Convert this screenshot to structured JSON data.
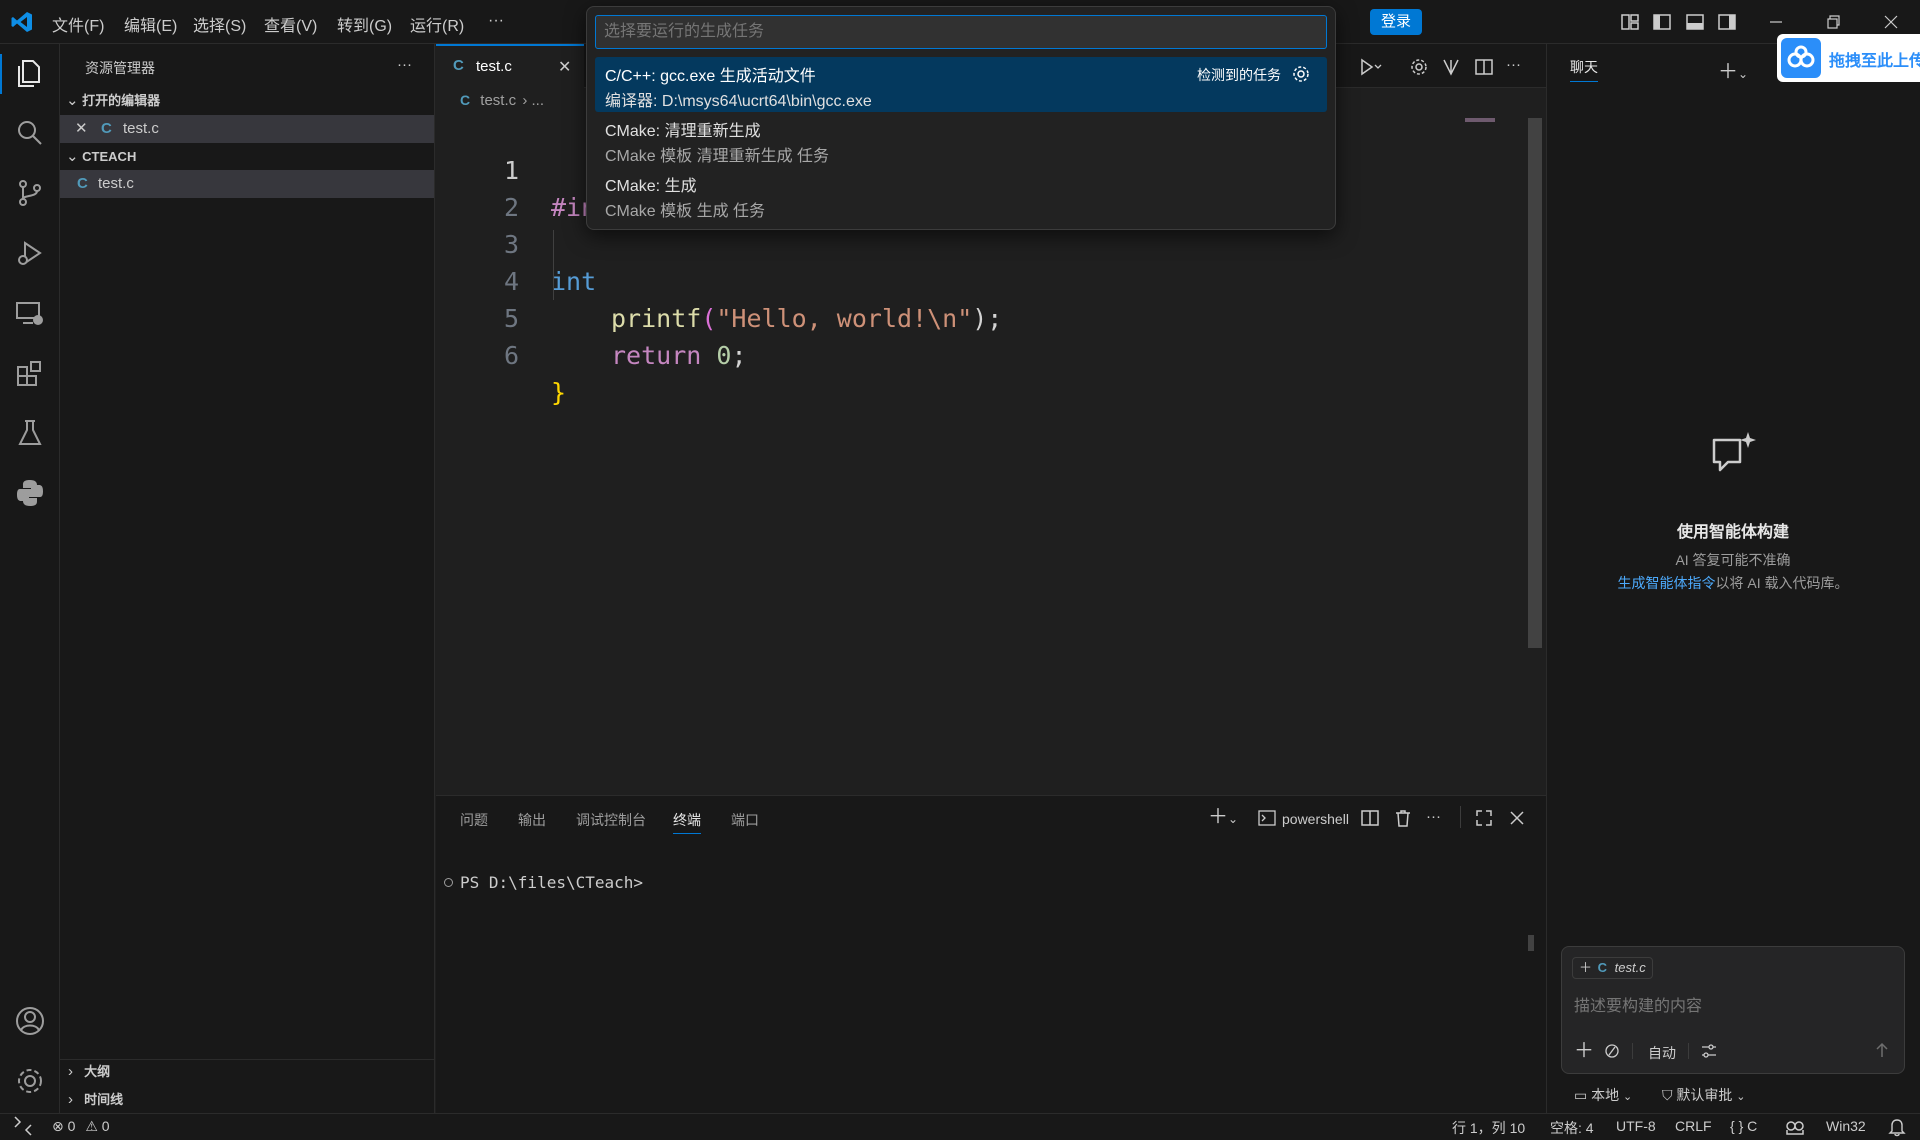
{
  "titlebar": {
    "menus": [
      "文件(F)",
      "编辑(E)",
      "选择(S)",
      "查看(V)",
      "转到(G)",
      "运行(R)",
      "···"
    ],
    "login_label": "登录"
  },
  "sidebar": {
    "title": "资源管理器",
    "more": "···",
    "open_editors_header": "打开的编辑器",
    "open_editor_file": "test.c",
    "folder_header": "CTEACH",
    "folder_file": "test.c",
    "outline_header": "大纲",
    "timeline_header": "时间线",
    "file_glyph": "C"
  },
  "editor": {
    "tab_label": "test.c",
    "tab_glyph": "C",
    "breadcrumb_file": "test.c",
    "breadcrumb_rest": "...",
    "lines": [
      {
        "n": "1",
        "frag_a": "#in",
        "frag_b": ""
      },
      {
        "n": "2"
      },
      {
        "n": "3",
        "frag_a": "int"
      },
      {
        "n": "4",
        "fn": "printf",
        "open": "(",
        "str": "\"Hello, world!\\n\"",
        "close": ");"
      },
      {
        "n": "5",
        "kw": "return",
        "num": "0",
        "end": ";"
      },
      {
        "n": "6",
        "brace": "}"
      }
    ]
  },
  "quickpick": {
    "placeholder": "选择要运行的生成任务",
    "items": [
      {
        "title": "C/C++: gcc.exe 生成活动文件",
        "desc": "编译器: D:\\msys64\\ucrt64\\bin\\gcc.exe",
        "badge": "检测到的任务",
        "selected": true
      },
      {
        "title": "CMake: 清理重新生成",
        "desc": "CMake 模板 清理重新生成 任务"
      },
      {
        "title": "CMake: 生成",
        "desc": "CMake 模板 生成 任务"
      }
    ]
  },
  "panel": {
    "tabs": [
      "问题",
      "输出",
      "调试控制台",
      "终端",
      "端口"
    ],
    "active_tab": "终端",
    "terminal_name": "powershell",
    "prompt": "PS D:\\files\\CTeach>"
  },
  "chat": {
    "title": "聊天",
    "heading": "使用智能体构建",
    "disclaimer": "AI 答复可能不准确",
    "link_text": "生成智能体指令",
    "link_suffix": "以将 AI 载入代码库。",
    "context_chip": "test.c",
    "input_placeholder": "描述要构建的内容",
    "mode_label": "自动",
    "bottom_left": "本地",
    "bottom_right": "默认审批",
    "baidu_text": "拖拽至此上传"
  },
  "statusbar": {
    "errors": "0",
    "warnings": "0",
    "position": "行 1，列 10",
    "spaces": "空格: 4",
    "encoding": "UTF-8",
    "eol": "CRLF",
    "language": "{ } C",
    "platform": "Win32"
  },
  "colors": {
    "accent": "#0078d4",
    "selection": "#04395e",
    "c_file": "#519aba"
  }
}
